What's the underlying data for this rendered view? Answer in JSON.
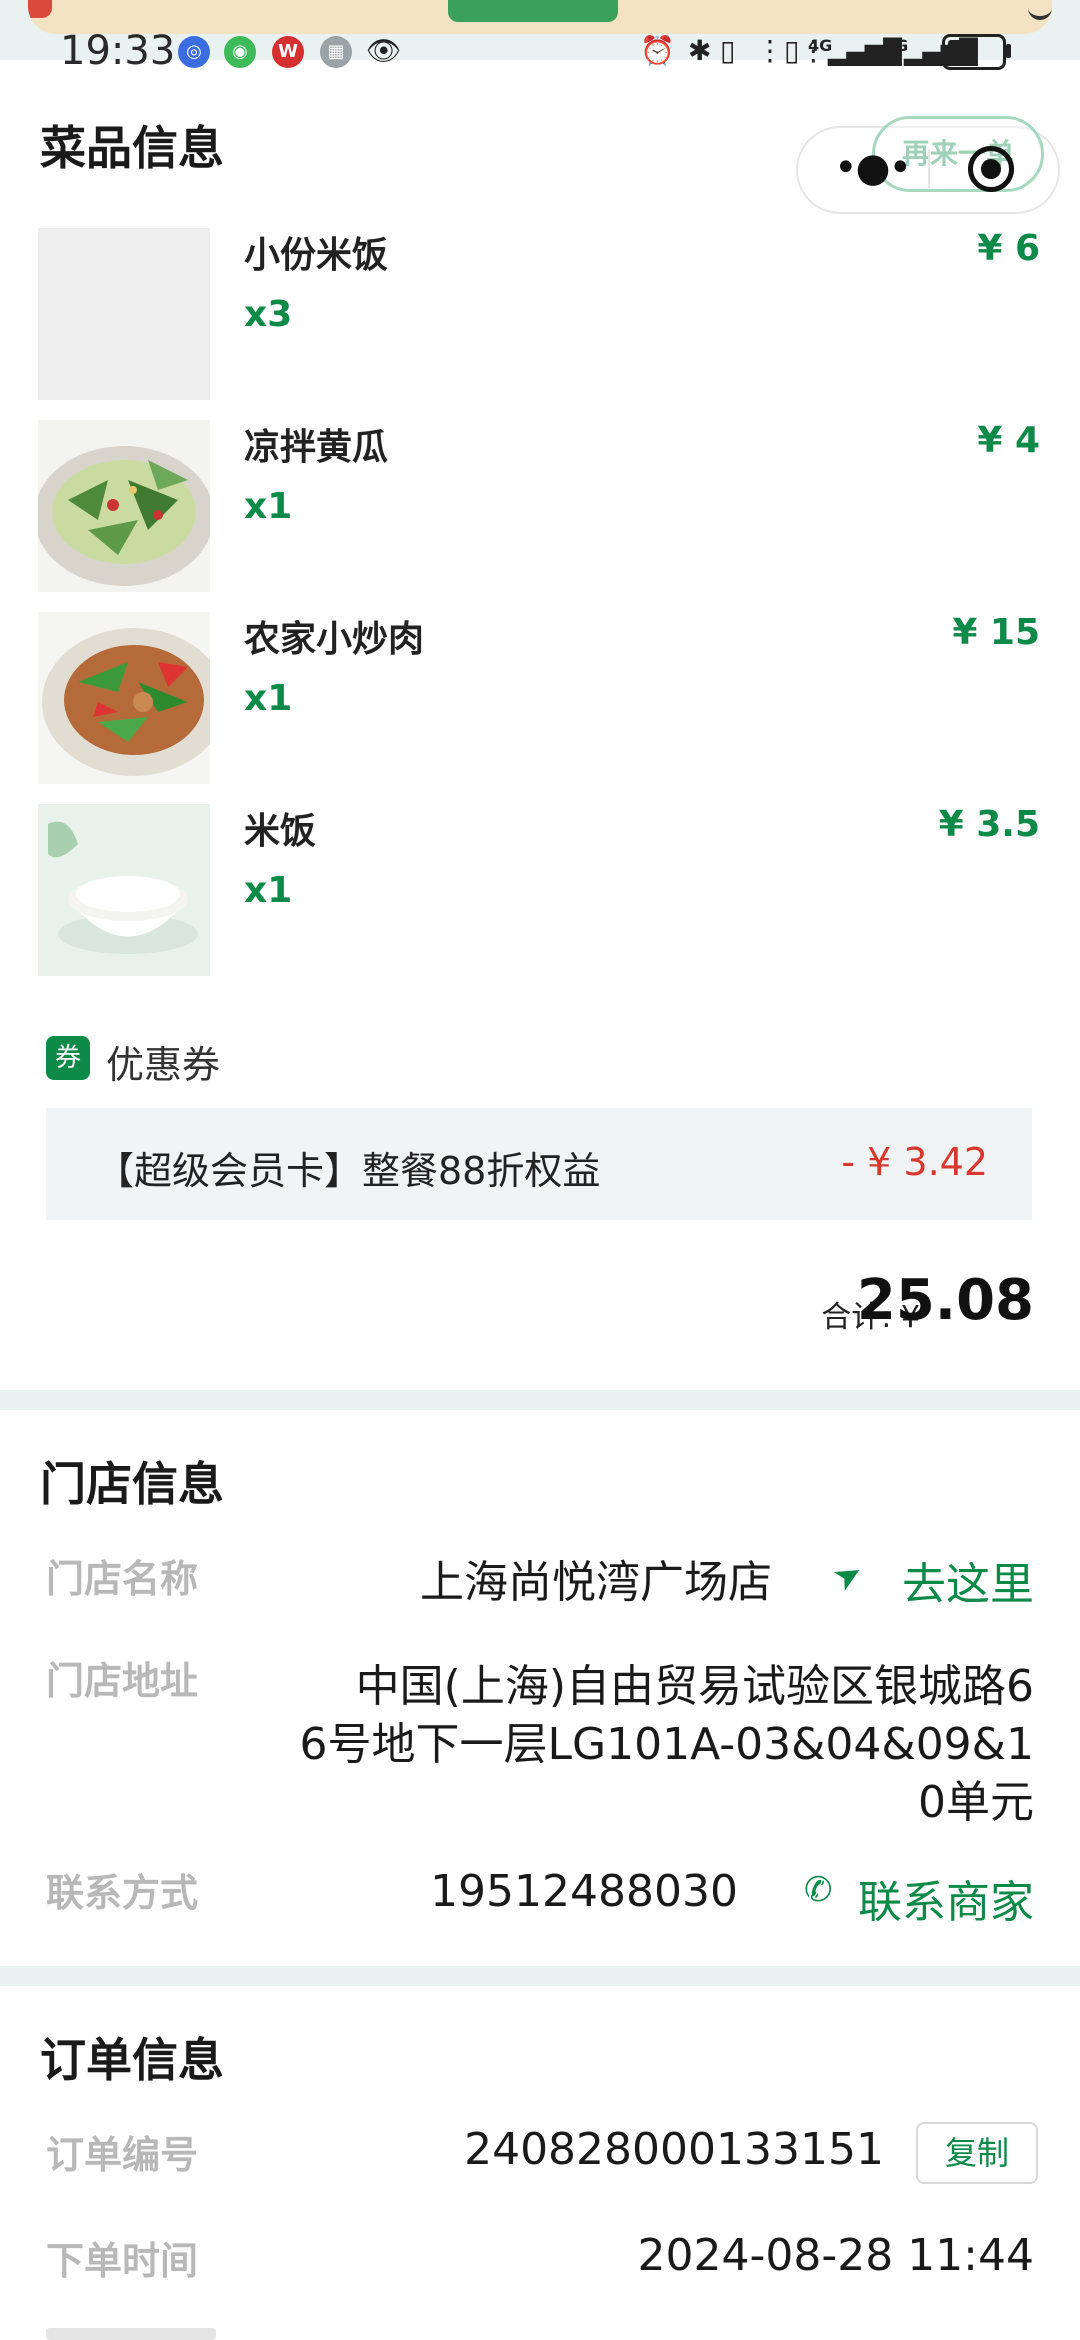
{
  "status_bar": {
    "time": "19:33",
    "network_labels": [
      "4G",
      "4G"
    ]
  },
  "header": {
    "reorder_label": "再来一单"
  },
  "dishes_section": {
    "title": "菜品信息",
    "items": [
      {
        "name": "小份米饭",
        "qty": "x3",
        "price": "¥ 6"
      },
      {
        "name": "凉拌黄瓜",
        "qty": "x1",
        "price": "¥ 4"
      },
      {
        "name": "农家小炒肉",
        "qty": "x1",
        "price": "¥ 15"
      },
      {
        "name": "米饭",
        "qty": "x1",
        "price": "¥ 3.5"
      }
    ]
  },
  "coupon": {
    "icon_text": "券",
    "label": "优惠券",
    "name": "【超级会员卡】整餐88折权益",
    "discount": "- ¥ 3.42"
  },
  "total": {
    "label": "合计: ¥",
    "value": "25.08"
  },
  "store_section": {
    "title": "门店信息",
    "name_label": "门店名称",
    "name_value": "上海尚悦湾广场店",
    "go_label": "去这里",
    "address_label": "门店地址",
    "address_lines": [
      "中国(上海)自由贸易试验区银城路6",
      "6号地下一层LG101A-03&04&09&1",
      "0单元"
    ],
    "contact_label": "联系方式",
    "contact_value": "19512488030",
    "contact_button": "联系商家"
  },
  "order_section": {
    "title": "订单信息",
    "number_label": "订单编号",
    "number_value": "240828000133151",
    "copy_label": "复制",
    "time_label": "下单时间",
    "time_value": "2024-08-28 11:44"
  },
  "colors": {
    "accent_green": "#0d8a48",
    "discount_red": "#d8372b",
    "section_gap": "#e9f2f0"
  }
}
